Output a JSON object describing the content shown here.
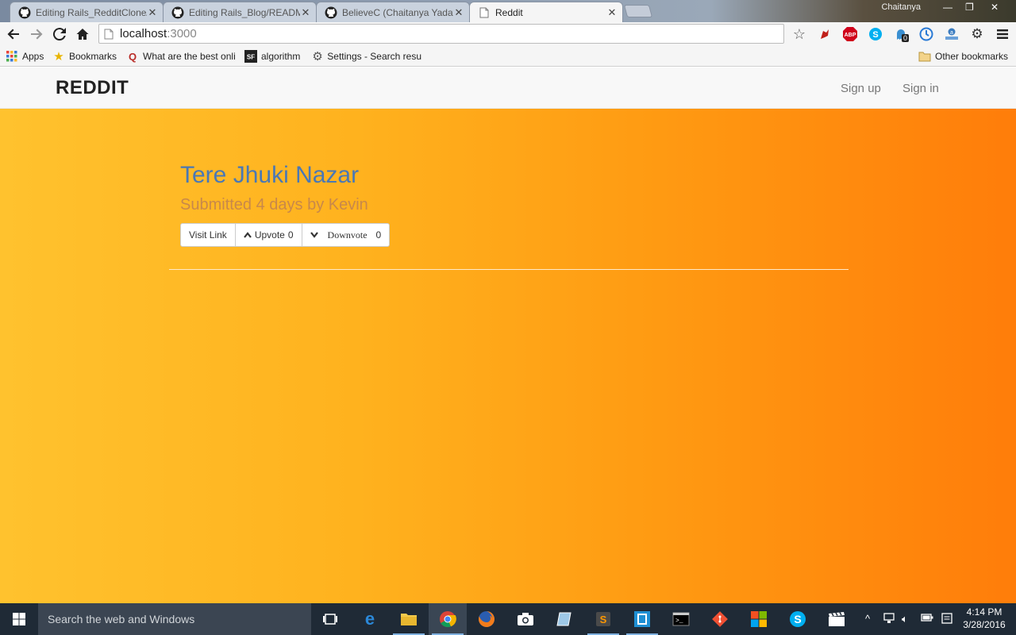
{
  "browser": {
    "tabs": [
      {
        "title": "Editing Rails_RedditClone/",
        "icon": "github-icon",
        "active": false
      },
      {
        "title": "Editing Rails_Blog/READM",
        "icon": "github-icon",
        "active": false
      },
      {
        "title": "BelieveC (Chaitanya Yadav",
        "icon": "github-icon",
        "active": false
      },
      {
        "title": "Reddit",
        "icon": "page-icon",
        "active": true
      }
    ],
    "user": "Chaitanya",
    "address": {
      "host": "localhost",
      "port": ":3000"
    },
    "bookmarks": [
      {
        "label": "Apps",
        "icon": "apps-grid-icon"
      },
      {
        "label": "Bookmarks",
        "icon": "star-icon"
      },
      {
        "label": "What are the best onli",
        "icon": "quora-icon"
      },
      {
        "label": "algorithm",
        "icon": "sf-icon"
      },
      {
        "label": "Settings - Search resu",
        "icon": "gear-icon"
      }
    ],
    "other_bookmarks": "Other bookmarks",
    "extensions": [
      "bookmark-star-icon",
      "lastpass-icon",
      "adblock-icon",
      "skype-icon",
      "ghostery-icon",
      "history-icon",
      "amazon-icon",
      "settings-icon",
      "menu-icon"
    ],
    "ghostery_badge": "0",
    "adblock_label": "ABP"
  },
  "page": {
    "brand": "REDDIT",
    "nav": {
      "signup": "Sign up",
      "signin": "Sign in"
    },
    "post": {
      "title": "Tere Jhuki Nazar",
      "meta": "Submitted 4 days by Kevin",
      "visit_label": "Visit Link",
      "upvote_label": "Upvote",
      "upvote_count": "0",
      "downvote_label": "Downvote",
      "downvote_count": "0"
    }
  },
  "taskbar": {
    "search_placeholder": "Search the web and Windows",
    "time": "4:14 PM",
    "date": "3/28/2016"
  }
}
